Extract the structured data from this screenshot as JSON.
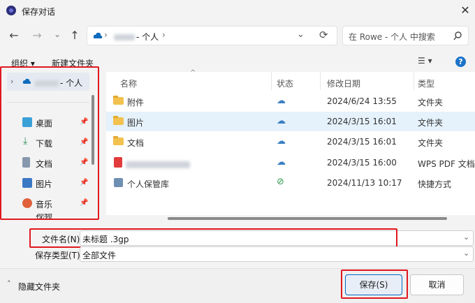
{
  "window": {
    "title": "保存对话",
    "close_glyph": "✕"
  },
  "nav": {
    "back": "←",
    "forward": "→",
    "down": "⌄",
    "up": "↑"
  },
  "address": {
    "separator": "›",
    "location": "- 个人",
    "refresh": "⟳",
    "dropdown": "⌄"
  },
  "search": {
    "placeholder": "在 Rowe - 个人 中搜索"
  },
  "toolbar": {
    "organize": "组织 ▾",
    "new_folder": "新建文件夹",
    "view": "☰ ▾",
    "help": "?"
  },
  "sidebar": {
    "root_label": "- 个人",
    "items": [
      {
        "label": "桌面",
        "icon": "desktop-icon",
        "color": "#3aa0d8"
      },
      {
        "label": "下载",
        "icon": "download-icon",
        "color": "#2d8c5a"
      },
      {
        "label": "文档",
        "icon": "document-icon",
        "color": "#7a8aa0"
      },
      {
        "label": "图片",
        "icon": "pictures-icon",
        "color": "#3b78c4"
      },
      {
        "label": "音乐",
        "icon": "music-icon",
        "color": "#e0603a"
      }
    ],
    "partial_label": "视频",
    "pin": "📌"
  },
  "columns": {
    "name": "名称",
    "status": "状态",
    "date": "修改日期",
    "type": "类型"
  },
  "files": [
    {
      "name": "附件",
      "date": "2024/6/24 13:55",
      "type": "文件夹",
      "status": "cloud"
    },
    {
      "name": "图片",
      "date": "2024/3/15 16:01",
      "type": "文件夹",
      "status": "cloud"
    },
    {
      "name": "文档",
      "date": "2024/3/15 16:01",
      "type": "文件夹",
      "status": "cloud"
    },
    {
      "name": "",
      "date": "2024/3/15 16:00",
      "type": "WPS PDF 文档",
      "status": "cloud"
    },
    {
      "name": "个人保管库",
      "date": "2024/11/13 10:17",
      "type": "快捷方式",
      "status": "ok"
    }
  ],
  "status_glyphs": {
    "cloud": "☁",
    "ok": "⊘"
  },
  "form": {
    "filename_label": "文件名(N):",
    "filename_value": "未标题 .3gp",
    "filetype_label": "保存类型(T):",
    "filetype_value": "全部文件"
  },
  "footer": {
    "hide_folders": "隐藏文件夹",
    "save": "保存(S)",
    "cancel": "取消"
  },
  "colors": {
    "highlight": "#e0181e",
    "accent": "#0067c0"
  }
}
